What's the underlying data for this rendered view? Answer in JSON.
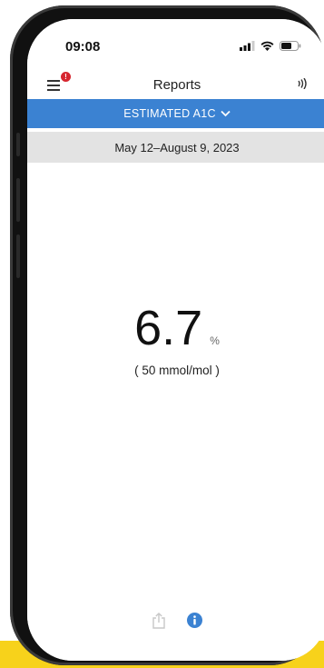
{
  "status_bar": {
    "time": "09:08"
  },
  "header": {
    "title": "Reports",
    "menu_badge": "!"
  },
  "report_selector": {
    "label": "ESTIMATED A1C"
  },
  "date_range": "May 12–August 9, 2023",
  "result": {
    "value": "6.7",
    "unit": "%",
    "alt_value": "( 50 mmol/mol )"
  },
  "colors": {
    "accent": "#3b82d2",
    "badge": "#d6262f",
    "background_strip": "#f7d21b"
  },
  "icons": [
    "menu-icon",
    "nfc-scan-icon",
    "share-icon",
    "info-icon"
  ]
}
